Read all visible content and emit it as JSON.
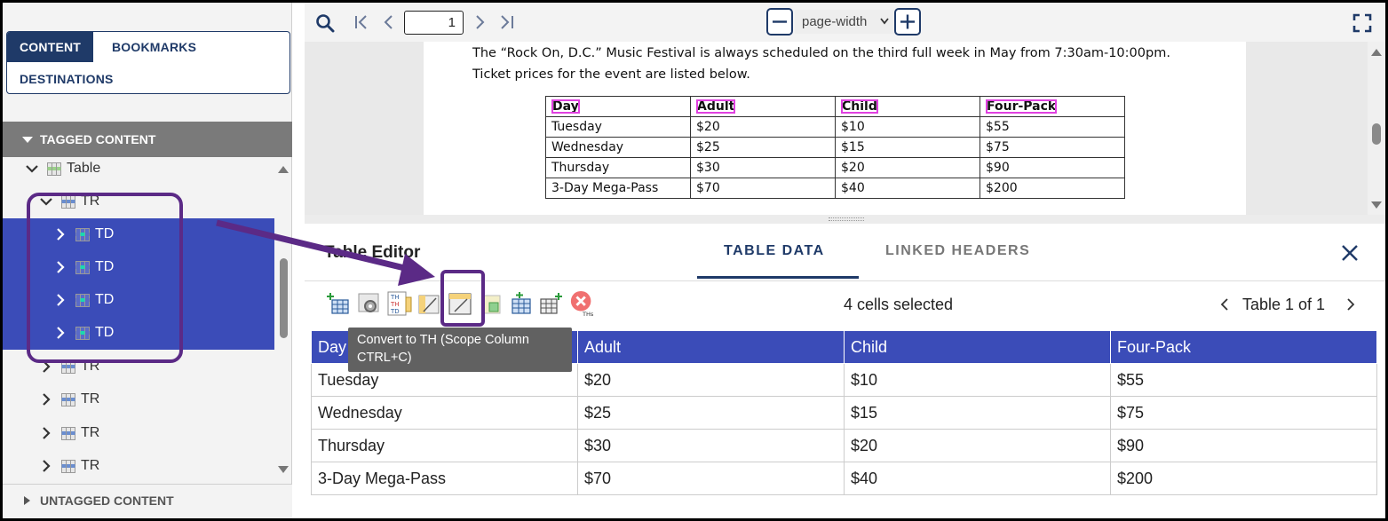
{
  "left_panel": {
    "tabs": [
      {
        "label": "CONTENT",
        "active": true
      },
      {
        "label": "BOOKMARKS",
        "active": false
      },
      {
        "label": "DESTINATIONS",
        "active": false
      }
    ],
    "tagged_content_label": "TAGGED CONTENT",
    "untagged_content_label": "UNTAGGED CONTENT",
    "tree": [
      {
        "label": "Table",
        "expanded": true,
        "selected": false,
        "icon": "table-icon"
      },
      {
        "label": "TR",
        "expanded": true,
        "selected": false,
        "icon": "table-row-icon"
      },
      {
        "label": "TD",
        "expanded": false,
        "selected": true,
        "icon": "table-cell-icon"
      },
      {
        "label": "TD",
        "expanded": false,
        "selected": true,
        "icon": "table-cell-icon"
      },
      {
        "label": "TD",
        "expanded": false,
        "selected": true,
        "icon": "table-cell-icon"
      },
      {
        "label": "TD",
        "expanded": false,
        "selected": true,
        "icon": "table-cell-icon"
      },
      {
        "label": "TR",
        "expanded": false,
        "selected": false,
        "icon": "table-row-icon"
      },
      {
        "label": "TR",
        "expanded": false,
        "selected": false,
        "icon": "table-row-icon"
      },
      {
        "label": "TR",
        "expanded": false,
        "selected": false,
        "icon": "table-row-icon"
      },
      {
        "label": "TR",
        "expanded": false,
        "selected": false,
        "icon": "table-row-icon"
      }
    ]
  },
  "toolbar": {
    "page_number": "1",
    "zoom_mode": "page-width",
    "icons": [
      "search-icon",
      "first-page-icon",
      "prev-page-icon",
      "next-page-icon",
      "last-page-icon",
      "zoom-out-icon",
      "zoom-in-icon",
      "fullscreen-icon"
    ]
  },
  "document": {
    "line1": "The “Rock On, D.C.” Music Festival is always scheduled on the third full week in May from 7:30am-10:00pm.",
    "line2": "Ticket prices for the event are listed below.",
    "table": {
      "headers": [
        "Day",
        "Adult",
        "Child",
        "Four-Pack"
      ],
      "rows": [
        [
          "Tuesday",
          "$20",
          "$10",
          "$55"
        ],
        [
          "Wednesday",
          "$25",
          "$15",
          "$75"
        ],
        [
          "Thursday",
          "$30",
          "$20",
          "$90"
        ],
        [
          "3-Day Mega-Pass",
          "$70",
          "$40",
          "$200"
        ]
      ]
    }
  },
  "editor": {
    "title": "Table Editor",
    "tabs": [
      {
        "label": "TABLE DATA",
        "active": true
      },
      {
        "label": "LINKED HEADERS",
        "active": false
      }
    ],
    "selection_status": "4 cells selected",
    "table_nav": "Table 1 of 1",
    "tool_icons": [
      "insert-row-icon",
      "settings-gear-icon",
      "convert-th-td-icon",
      "convert-th-scope-row-icon",
      "convert-th-scope-column-icon",
      "merge-cells-icon",
      "insert-column-icon",
      "add-column-icon",
      "remove-th-icon"
    ],
    "tooltip": "Convert to TH (Scope Column CTRL+C)",
    "table": {
      "headers": [
        "Day",
        "Adult",
        "Child",
        "Four-Pack"
      ],
      "rows": [
        [
          "Tuesday",
          "$20",
          "$10",
          "$55"
        ],
        [
          "Wednesday",
          "$25",
          "$15",
          "$75"
        ],
        [
          "Thursday",
          "$30",
          "$20",
          "$90"
        ],
        [
          "3-Day  Mega-Pass",
          "$70",
          "$40",
          "$200"
        ]
      ]
    }
  },
  "colors": {
    "navy": "#1f3a68",
    "selection_blue": "#3b4cb8",
    "annotation_purple": "#5b2a86",
    "tag_highlight": "#e040e0"
  }
}
